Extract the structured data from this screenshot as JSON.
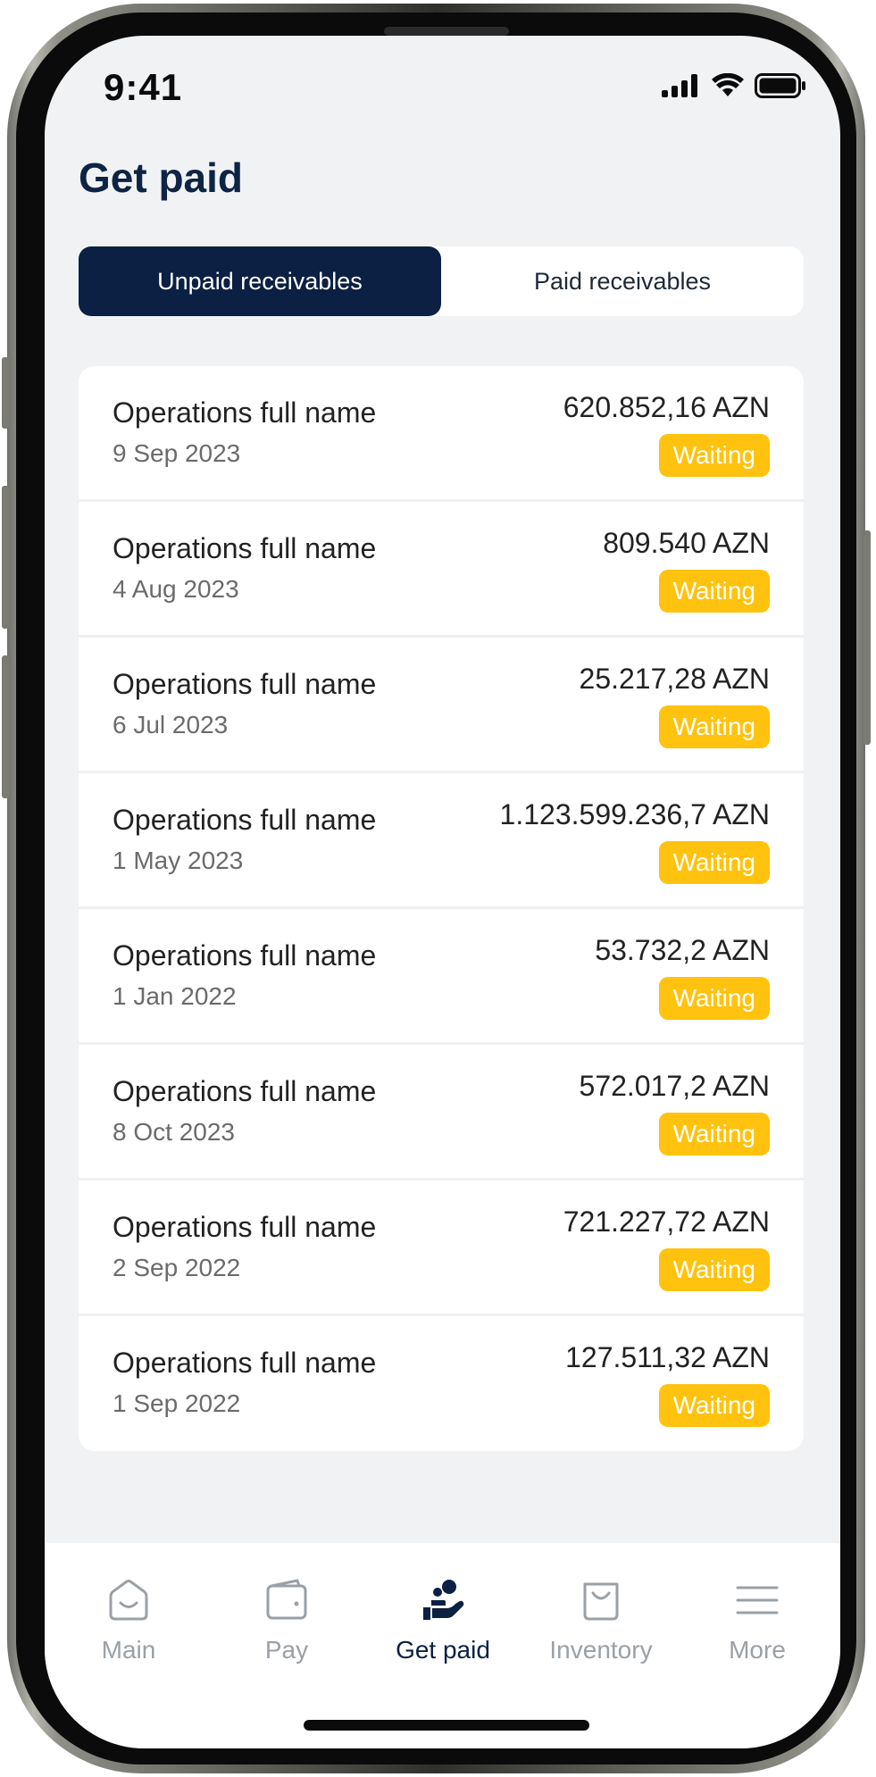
{
  "status_bar": {
    "time": "9:41"
  },
  "page_title": "Get paid",
  "tabs": {
    "unpaid": "Unpaid receivables",
    "paid": "Paid receivables"
  },
  "receivables": [
    {
      "name": "Operations full name",
      "date": "9 Sep 2023",
      "amount": "620.852,16 AZN",
      "status": "Waiting"
    },
    {
      "name": "Operations full name",
      "date": "4 Aug 2023",
      "amount": "809.540 AZN",
      "status": "Waiting"
    },
    {
      "name": "Operations full name",
      "date": "6 Jul 2023",
      "amount": "25.217,28 AZN",
      "status": "Waiting"
    },
    {
      "name": "Operations full name",
      "date": "1 May 2023",
      "amount": "1.123.599.236,7 AZN",
      "status": "Waiting"
    },
    {
      "name": "Operations full name",
      "date": "1 Jan 2022",
      "amount": "53.732,2 AZN",
      "status": "Waiting"
    },
    {
      "name": "Operations full name",
      "date": "8 Oct 2023",
      "amount": "572.017,2 AZN",
      "status": "Waiting"
    },
    {
      "name": "Operations full name",
      "date": "2 Sep 2022",
      "amount": "721.227,72 AZN",
      "status": "Waiting"
    },
    {
      "name": "Operations full name",
      "date": "1 Sep 2022",
      "amount": "127.511,32 AZN",
      "status": "Waiting"
    }
  ],
  "nav": [
    {
      "label": "Main",
      "icon": "home-icon",
      "active": false
    },
    {
      "label": "Pay",
      "icon": "wallet-icon",
      "active": false
    },
    {
      "label": "Get paid",
      "icon": "get-paid-icon",
      "active": true
    },
    {
      "label": "Inventory",
      "icon": "bag-icon",
      "active": false
    },
    {
      "label": "More",
      "icon": "menu-icon",
      "active": false
    }
  ],
  "colors": {
    "primary": "#0b2042",
    "waiting_badge": "#ffc20e",
    "background": "#f1f2f4",
    "inactive_nav": "#9aa0a6"
  }
}
